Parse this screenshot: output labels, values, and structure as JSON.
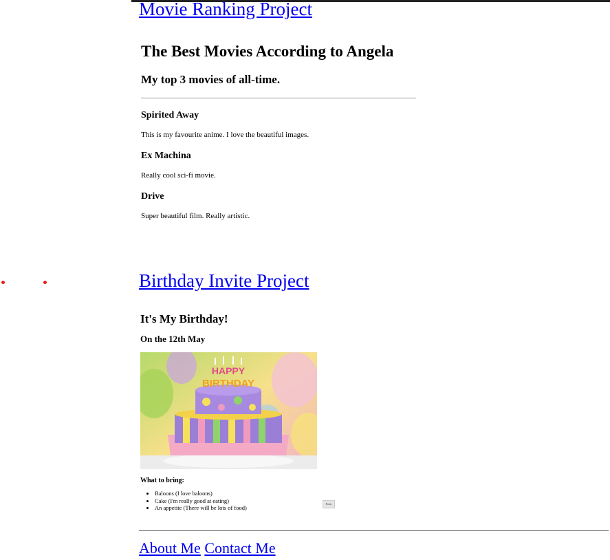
{
  "movie_project": {
    "link_text": "Movie Ranking Project",
    "preview": {
      "title": "The Best Movies According to Angela",
      "subtitle": "My top 3 movies of all-time.",
      "movies": [
        {
          "title": "Spirited Away",
          "description": "This is my favourite anime. I love the beautiful images."
        },
        {
          "title": "Ex Machina",
          "description": "Really cool sci-fi movie."
        },
        {
          "title": "Drive",
          "description": "Super beautiful film. Really artistic."
        }
      ]
    }
  },
  "birthday_project": {
    "link_text": "Birthday Invite Project",
    "preview": {
      "heading": "It's My Birthday!",
      "date": "On the 12th May",
      "cake_text": "HAPPY BIRTHDAY",
      "bring_heading": "What to bring:",
      "items": [
        "Baloons (I love baloons)",
        "Cake (I'm really good at eating)",
        "An appetite (There will be lots of food)"
      ],
      "form_button_label": "Form"
    }
  },
  "footer": {
    "about_label": "About Me",
    "contact_label": "Contact Me"
  },
  "colors": {
    "link": "#0000ee",
    "bullet": "#e02020",
    "top_bar": "#222222"
  }
}
